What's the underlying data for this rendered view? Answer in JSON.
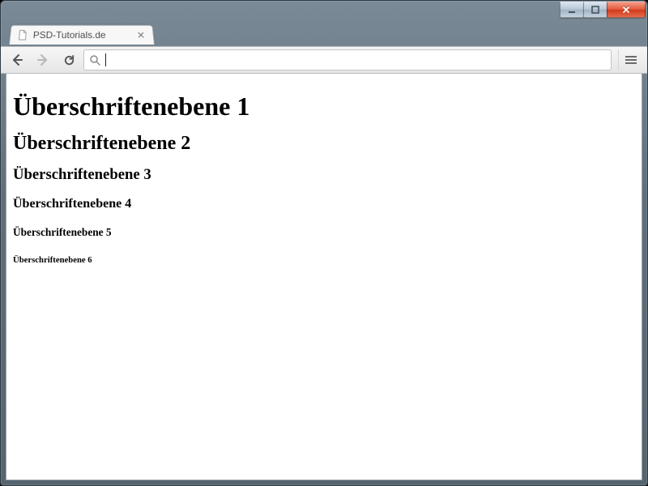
{
  "window": {
    "minimize_tooltip": "Minimize",
    "maximize_tooltip": "Maximize",
    "close_tooltip": "Close"
  },
  "tab": {
    "title": "PSD-Tutorials.de"
  },
  "toolbar": {
    "address_value": "",
    "address_placeholder": ""
  },
  "page": {
    "h1": "Überschriftenebene 1",
    "h2": "Überschriftenebene 2",
    "h3": "Überschriftenebene 3",
    "h4": "Überschriftenebene 4",
    "h5": "Überschriftenebene 5",
    "h6": "Überschriftenebene 6"
  }
}
